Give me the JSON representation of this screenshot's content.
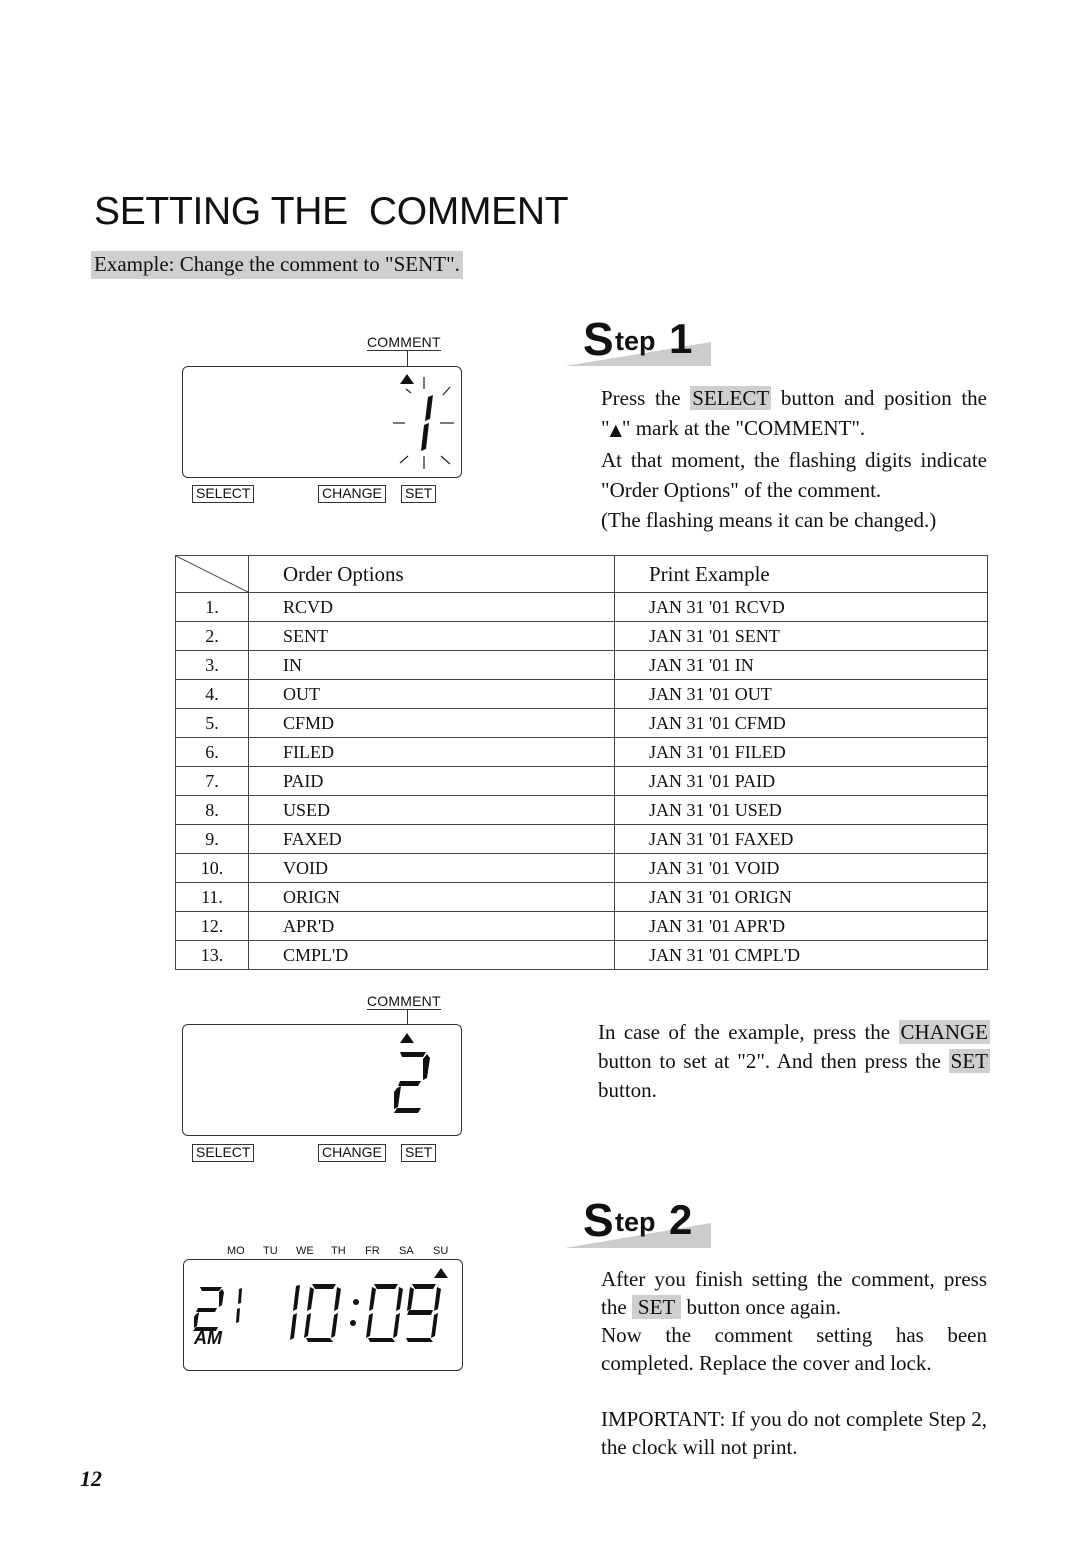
{
  "page": {
    "title": "SETTING THE  COMMENT",
    "example": "Example: Change the comment to \"SENT\".",
    "page_number": "12"
  },
  "display1": {
    "label": "COMMENT",
    "digit": "1",
    "state": "flashing",
    "keys": [
      "SELECT",
      "CHANGE",
      "SET"
    ]
  },
  "display2": {
    "label": "COMMENT",
    "digit": "2",
    "keys": [
      "SELECT",
      "CHANGE",
      "SET"
    ]
  },
  "display3": {
    "weekdays": [
      "MO",
      "TU",
      "WE",
      "TH",
      "FR",
      "SA",
      "SU"
    ],
    "date": "21",
    "ampm": "AM",
    "time": "10:09"
  },
  "step1": {
    "heading_s": "S",
    "heading_tep": "tep",
    "heading_num": "1",
    "p1_before": "Press the ",
    "p1_hl": "SELECT",
    "p1_after": " button and position the",
    "p2_before": "\"",
    "p2_icon": "▲",
    "p2_after": "\" mark at the \"COMMENT\".",
    "p3": "At that moment, the flashing digits indicate",
    "p4": "\"Order Options\" of the comment.",
    "p5": "(The flashing means it can be changed.)"
  },
  "table": {
    "headers": [
      "",
      "Order Options",
      "Print Example"
    ],
    "rows": [
      {
        "num": "1.",
        "option": "RCVD",
        "example": "JAN 31 '01 RCVD"
      },
      {
        "num": "2.",
        "option": "SENT",
        "example": "JAN 31 '01 SENT"
      },
      {
        "num": "3.",
        "option": "IN",
        "example": "JAN 31 '01 IN"
      },
      {
        "num": "4.",
        "option": "OUT",
        "example": "JAN 31 '01 OUT"
      },
      {
        "num": "5.",
        "option": "CFMD",
        "example": "JAN 31 '01 CFMD"
      },
      {
        "num": "6.",
        "option": "FILED",
        "example": "JAN 31 '01 FILED"
      },
      {
        "num": "7.",
        "option": "PAID",
        "example": "JAN 31 '01 PAID"
      },
      {
        "num": "8.",
        "option": "USED",
        "example": "JAN 31 '01 USED"
      },
      {
        "num": "9.",
        "option": "FAXED",
        "example": "JAN 31 '01 FAXED"
      },
      {
        "num": "10.",
        "option": "VOID",
        "example": "JAN 31 '01 VOID"
      },
      {
        "num": "11.",
        "option": "ORIGN",
        "example": "JAN 31 '01 ORIGN"
      },
      {
        "num": "12.",
        "option": "APR'D",
        "example": "JAN 31 '01 APR'D"
      },
      {
        "num": "13.",
        "option": "CMPL'D",
        "example": "JAN 31 '01 CMPL'D"
      }
    ]
  },
  "middle_text": {
    "l1_before": "In case of the example, press the ",
    "l1_hl": "CHANGE",
    "l2_before": "button to set at \"2\". And then press the ",
    "l2_hl": "SET",
    "l3": "button."
  },
  "step2": {
    "heading_s": "S",
    "heading_tep": "tep",
    "heading_num": "2",
    "p1": "After you finish setting the comment, press",
    "p2_before": "the ",
    "p2_hl": "SET",
    "p2_after": " button once again.",
    "p3": "Now the comment setting has been completed. Replace the cover and lock.",
    "p4": "IMPORTANT: If you do not complete Step 2, the clock will not print."
  },
  "colors": {
    "highlight": "#cfcfcf",
    "wedge": "#cccccc",
    "ink": "#111111"
  }
}
